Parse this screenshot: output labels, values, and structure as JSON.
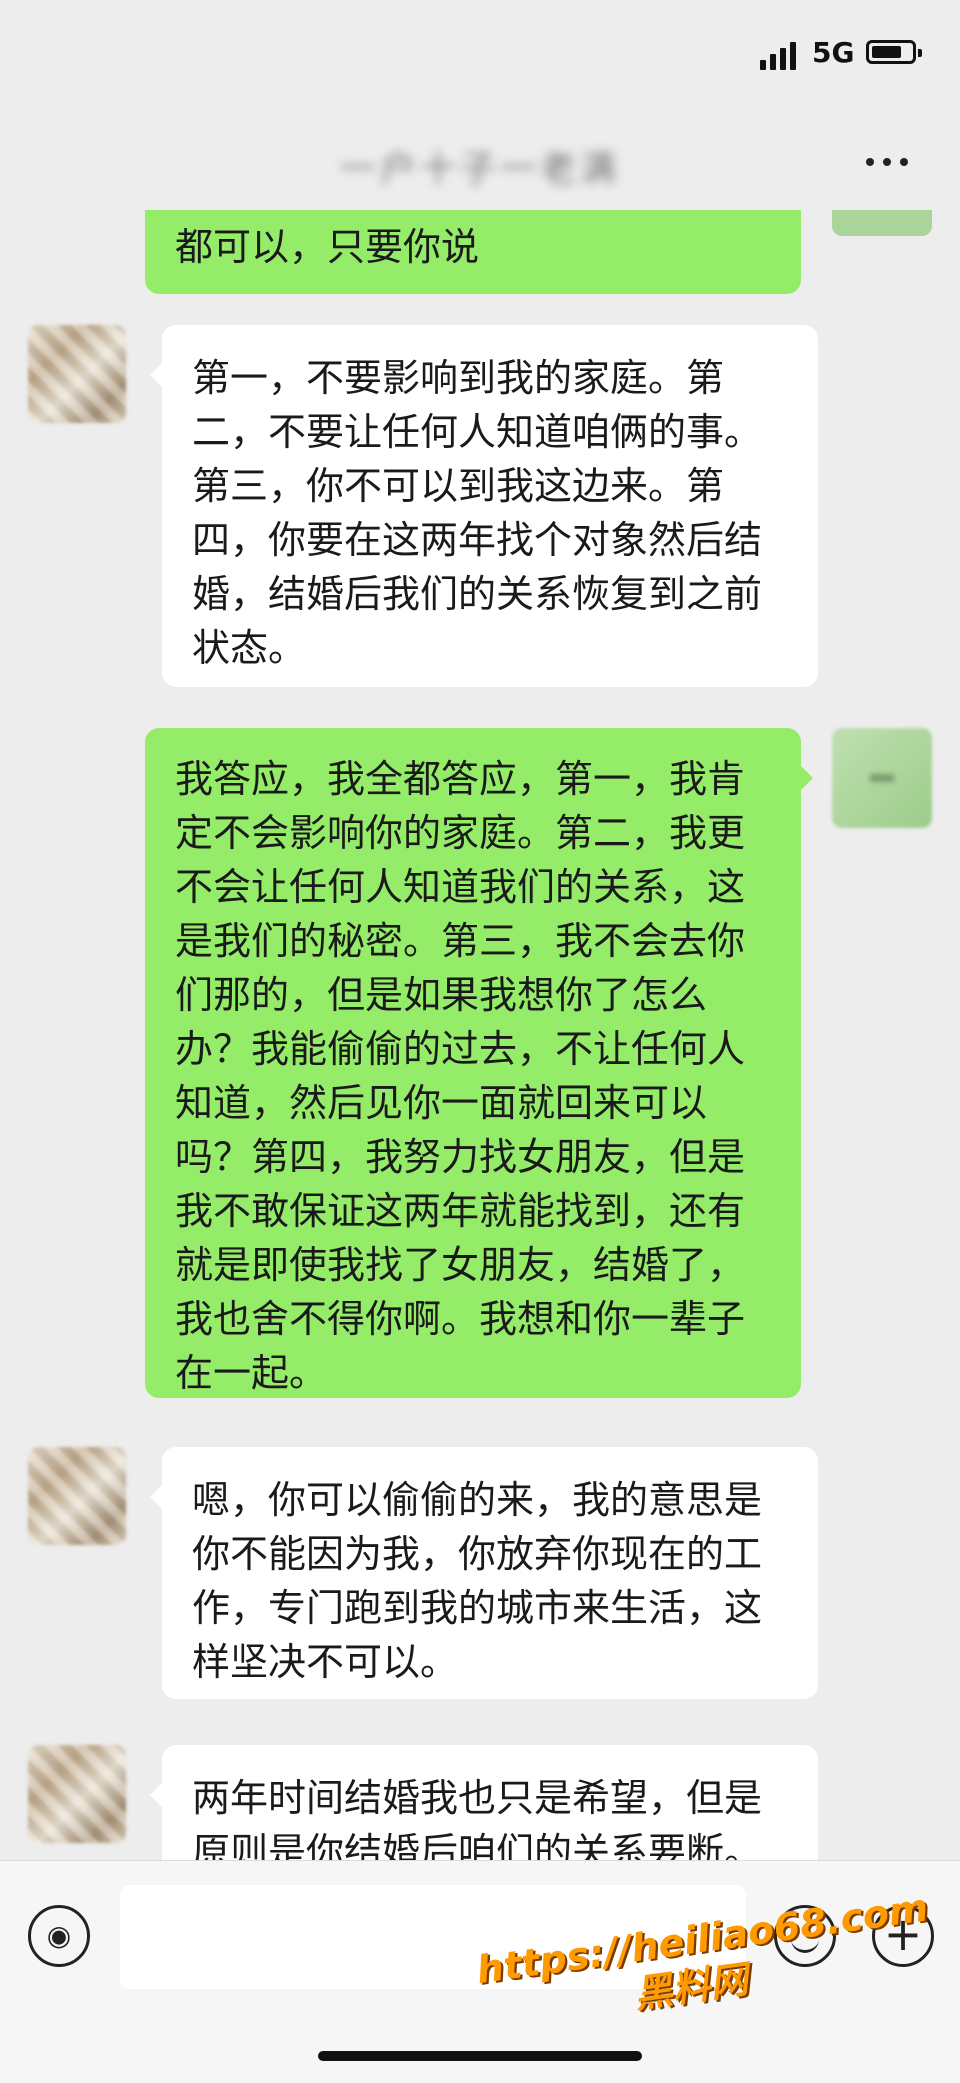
{
  "status_bar": {
    "network": "5G",
    "battery_level": 0.75
  },
  "header": {
    "title": "一户十子一老满"
  },
  "messages": [
    {
      "side": "right",
      "text": "都可以，只要你说"
    },
    {
      "side": "left",
      "text": "第一，不要影响到我的家庭。第二，不要让任何人知道咱俩的事。第三，你不可以到我这边来。第四，你要在这两年找个对象然后结婚，结婚后我们的关系恢复到之前状态。"
    },
    {
      "side": "right",
      "text": "我答应，我全都答应，第一，我肯定不会影响你的家庭。第二，我更不会让任何人知道我们的关系，这是我们的秘密。第三，我不会去你们那的，但是如果我想你了怎么办？我能偷偷的过去，不让任何人知道，然后见你一面就回来可以吗？第四，我努力找女朋友，但是我不敢保证这两年就能找到，还有就是即使我找了女朋友，结婚了，我也舍不得你啊。我想和你一辈子在一起。"
    },
    {
      "side": "left",
      "text": "嗯，你可以偷偷的来，我的意思是你不能因为我，你放弃你现在的工作，专门跑到我的城市来生活，这样坚决不可以。"
    },
    {
      "side": "left",
      "text": "两年时间结婚我也只是希望，但是原则是你结婚后咱们的关系要断。"
    }
  ],
  "watermark": {
    "url": "https://heiliao68.com",
    "name": "黑料网"
  },
  "colors": {
    "background": "#ededed",
    "bubble_mine": "#95ec69",
    "bubble_other": "#ffffff",
    "watermark": "#ff9a00"
  },
  "icons": [
    "signal-icon",
    "battery-icon",
    "more-icon",
    "voice-icon",
    "emoji-icon",
    "plus-icon"
  ]
}
